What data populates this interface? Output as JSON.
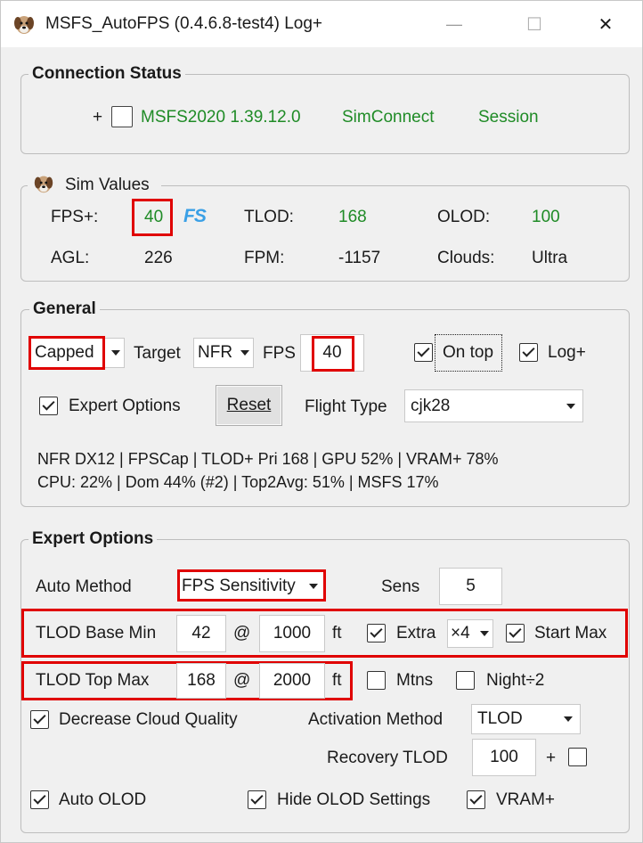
{
  "window": {
    "title": "MSFS_AutoFPS (0.4.6.8-test4) Log+",
    "minimize": "—",
    "maximize": "☐",
    "close": "✕"
  },
  "connection": {
    "group_title": "Connection Status",
    "plus": "+",
    "msfs": "MSFS2020 1.39.12.0",
    "simconnect": "SimConnect",
    "session": "Session",
    "status_color": "#1f8b26"
  },
  "sim": {
    "group_title": "Sim Values",
    "fps_label": "FPS+:",
    "fps_value": "40",
    "fs_badge": "FS",
    "tlod_label": "TLOD:",
    "tlod_value": "168",
    "olod_label": "OLOD:",
    "olod_value": "100",
    "agl_label": "AGL:",
    "agl_value": "226",
    "fpm_label": "FPM:",
    "fpm_value": "-1157",
    "clouds_label": "Clouds:",
    "clouds_value": "Ultra"
  },
  "general": {
    "group_title": "General",
    "mode": "Capped",
    "target_label": "Target",
    "target_value": "NFR",
    "fps_label": "FPS",
    "fps_value": "40",
    "on_top_label": "On top",
    "on_top_checked": true,
    "log_label": "Log+",
    "log_checked": true,
    "expert_label": "Expert Options",
    "expert_checked": true,
    "reset_label": "Reset",
    "flight_type_label": "Flight Type",
    "flight_type_value": "cjk28",
    "status_line1": "NFR DX12 | FPSCap | TLOD+ Pri 168 | GPU 52% | VRAM+ 78%",
    "status_line2": "CPU: 22% | Dom 44% (#2) | Top2Avg: 51% | MSFS 17%"
  },
  "expert": {
    "group_title": "Expert Options",
    "auto_method_label": "Auto Method",
    "auto_method_value": "FPS Sensitivity",
    "sens_label": "Sens",
    "sens_value": "5",
    "tlod_base_label": "TLOD Base Min",
    "tlod_base_value": "42",
    "at": "@",
    "tlod_base_alt": "1000",
    "ft": "ft",
    "extra_label": "Extra",
    "extra_checked": true,
    "extra_mult": "×4",
    "start_max_label": "Start Max",
    "start_max_checked": true,
    "tlod_top_label": "TLOD Top Max",
    "tlod_top_value": "168",
    "tlod_top_alt": "2000",
    "mtns_label": "Mtns",
    "mtns_checked": false,
    "night_label": "Night÷2",
    "night_checked": false,
    "decrease_cloud_label": "Decrease Cloud Quality",
    "decrease_cloud_checked": true,
    "activation_label": "Activation Method",
    "activation_value": "TLOD",
    "recovery_label": "Recovery TLOD",
    "recovery_value": "100",
    "recovery_plus": "+",
    "auto_olod_label": "Auto OLOD",
    "auto_olod_checked": true,
    "hide_olod_label": "Hide OLOD Settings",
    "hide_olod_checked": true,
    "vram_label": "VRAM+",
    "vram_checked": true
  },
  "highlight_color": "#e00000"
}
